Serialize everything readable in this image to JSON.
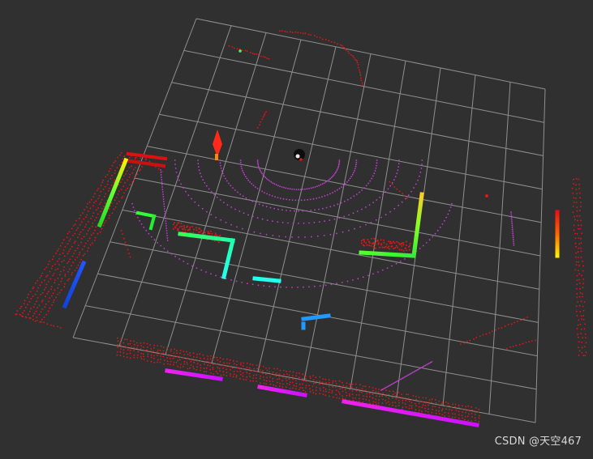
{
  "viewer": {
    "background": "#303030",
    "grid_color": "#9a9a9a",
    "grid_cells": 10,
    "point_colors": {
      "laser": "#e01818",
      "pointcloud_primary": "#c040d0",
      "robot": "#111111"
    }
  },
  "watermark": {
    "text": "CSDN @天空467"
  },
  "markers": [
    {
      "name": "wall-marker-left-upper",
      "colors": [
        "#ffee00",
        "#66ff33",
        "#22dd22"
      ]
    },
    {
      "name": "wall-marker-left-lower",
      "colors": [
        "#2255ff",
        "#1144dd"
      ]
    },
    {
      "name": "wall-marker-center",
      "colors": [
        "#33ff55",
        "#22ffaa",
        "#22ffee"
      ]
    },
    {
      "name": "wall-marker-right",
      "colors": [
        "#ffcc22",
        "#88ff22",
        "#33ee33"
      ]
    },
    {
      "name": "wall-marker-far-right",
      "colors": [
        "#ffee00",
        "#ff6600",
        "#ee1111"
      ]
    },
    {
      "name": "floor-marker-magenta",
      "colors": [
        "#ee22ee",
        "#cc11ff"
      ]
    },
    {
      "name": "marker-cyan",
      "colors": [
        "#22ffee"
      ]
    },
    {
      "name": "marker-blue",
      "colors": [
        "#2299ff"
      ]
    }
  ]
}
